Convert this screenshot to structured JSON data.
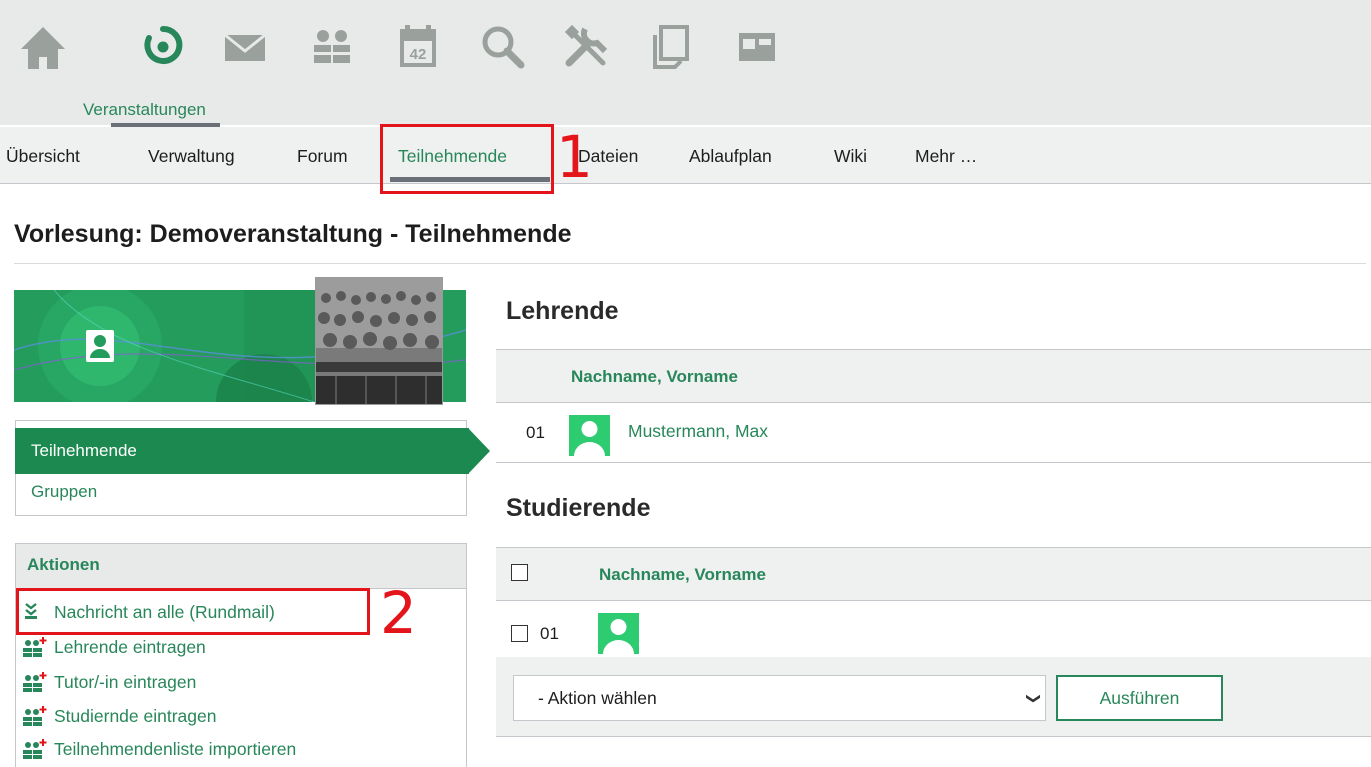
{
  "topnav": {
    "icons": [
      "home-icon",
      "courses-icon",
      "messages-icon",
      "community-icon",
      "calendar-icon",
      "search-icon",
      "tools-icon",
      "files-icon",
      "browse-icon"
    ],
    "calendar_day": "42",
    "active_label": "Veranstaltungen"
  },
  "subnav": {
    "items": [
      "Übersicht",
      "Verwaltung",
      "Forum",
      "Teilnehmende",
      "Dateien",
      "Ablaufplan",
      "Wiki",
      "Mehr …"
    ],
    "active_index": 3
  },
  "annotations": {
    "marker_1": "1",
    "marker_2": "2",
    "color": "#e3151a"
  },
  "page": {
    "title": "Vorlesung: Demoveranstaltung - Teilnehmende"
  },
  "sidebar": {
    "nav": [
      "Teilnehmende",
      "Gruppen"
    ],
    "actions_title": "Aktionen",
    "actions": [
      {
        "icon": "mail-all-icon",
        "label": "Nachricht an alle (Rundmail)"
      },
      {
        "icon": "add-person-icon",
        "label": "Lehrende eintragen"
      },
      {
        "icon": "add-person-icon",
        "label": "Tutor/-in eintragen"
      },
      {
        "icon": "add-person-icon",
        "label": "Studiernde eintragen"
      },
      {
        "icon": "add-person-icon",
        "label": "Teilnehmendenliste importieren"
      }
    ]
  },
  "lecturers": {
    "title": "Lehrende",
    "column": "Nachname, Vorname",
    "rows": [
      {
        "num": "01",
        "name": "Mustermann, Max"
      }
    ]
  },
  "students": {
    "title": "Studierende",
    "column": "Nachname, Vorname",
    "rows": [
      {
        "num": "01",
        "name": ""
      }
    ]
  },
  "bulk": {
    "select_value": "- Aktion wählen",
    "button": "Ausführen"
  },
  "colors": {
    "accent": "#28875a",
    "active_nav": "#1c8a50",
    "avatar": "#2ecc71",
    "icon_gray": "#9aa09c"
  }
}
